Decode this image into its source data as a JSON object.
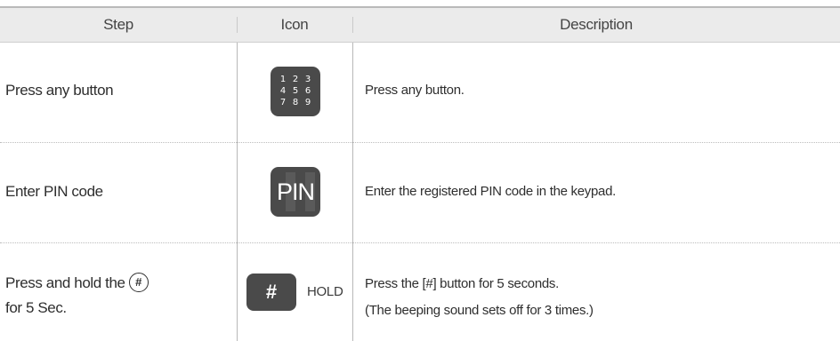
{
  "header": {
    "step": "Step",
    "icon": "Icon",
    "description": "Description"
  },
  "rows": [
    {
      "step": "Press any button",
      "icon": "keypad-icon",
      "keypad_digits": [
        "1",
        "2",
        "3",
        "4",
        "5",
        "6",
        "7",
        "8",
        "9"
      ],
      "description": "Press any button."
    },
    {
      "step": "Enter PIN code",
      "icon": "pin-icon",
      "icon_text": "PIN",
      "description": "Enter the registered PIN code in the keypad."
    },
    {
      "step_line1": "Press and hold the",
      "step_symbol": "#",
      "step_line2": "for 5 Sec.",
      "icon": "hash-button-icon",
      "icon_text": "#",
      "icon_label": "HOLD",
      "description_line1": "Press the [#] button for 5 seconds.",
      "description_line2": "(The beeping sound sets off for 3 times.)"
    }
  ],
  "colors": {
    "header_bg": "#ebebeb",
    "icon_bg": "#4a4a4a",
    "text": "#2e2e2e"
  }
}
